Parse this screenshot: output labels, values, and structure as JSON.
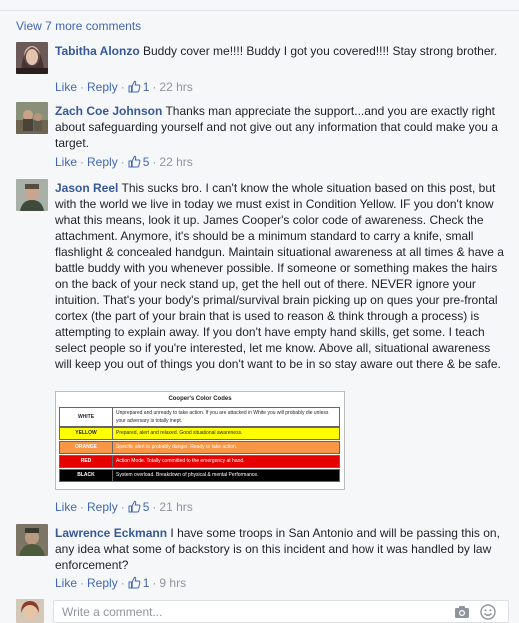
{
  "view_more": "View 7 more comments",
  "actions_common": {
    "like": "Like",
    "reply": "Reply",
    "dot": "·"
  },
  "comments": [
    {
      "author": "Tabitha Alonzo",
      "text": "Buddy cover me!!!! Buddy I got you covered!!!! Stay strong brother.",
      "likes": "1",
      "time": "22 hrs"
    },
    {
      "author": "Zach Coe Johnson",
      "text": "Thanks man appreciate the support...and you are exactly right about safeguarding yourself and not give out any information that could make you a target.",
      "likes": "5",
      "time": "22 hrs"
    },
    {
      "author": "Jason Reel",
      "text": "This sucks bro. I can't know the whole situation based on this post, but with the world we live in today we must exist in Condition Yellow. IF you don't know what this means, look it up. James Cooper's color code of awareness. Check the attachment. Anymore, it's should be a minimum standard to carry a knife, small flashlight & concealed handgun. Maintain situational awareness at all times & have a battle buddy with you whenever possible. If someone or something makes the hairs on the back of your neck stand up, get the hell out of there. NEVER ignore your intuition. That's your body's primal/survival brain picking up on ques your pre-frontal cortex (the part of your brain that is used to reason & think through a process) is attempting to explain away. If you don't have empty hand skills, get some. I teach select people so if you're interested, let me know. Above all, situational awareness will keep you out of things you don't want to be in so stay aware out there & be safe.",
      "likes": "5",
      "time": "21 hrs"
    },
    {
      "author": "Lawrence Eckmann",
      "text": "I have some troops in San Antonio and will be passing this on, any idea what some of backstory is on this incident and how it was handled by law enforcement?",
      "likes": "1",
      "time": "9 hrs"
    }
  ],
  "attachment": {
    "title": "Cooper's Color Codes",
    "rows": [
      {
        "name": "WHITE",
        "desc": "Unprepared and unready to take action. If you are attacked in White you will probably die unless your adversary is totally inept.",
        "bg": "#ffffff",
        "fg": "#000000"
      },
      {
        "name": "YELLOW",
        "desc": "Prepared, alert and relaxed. Good situational awareness.",
        "bg": "#ffff00",
        "fg": "#000000"
      },
      {
        "name": "ORANGE",
        "desc": "Specific alert to probably danger.  Ready to take action.",
        "bg": "#f79646",
        "fg": "#ffffff"
      },
      {
        "name": "RED",
        "desc": "Action Mode.  Totally committed to the emergency at hand.",
        "bg": "#e60000",
        "fg": "#ffffff"
      },
      {
        "name": "BLACK",
        "desc": "System overload.  Breakdown of physical & mental Performance.",
        "bg": "#000000",
        "fg": "#ffffff"
      }
    ]
  },
  "write_comment": {
    "placeholder": "Write a comment..."
  },
  "icons": {
    "like": "thumbs-up-icon",
    "camera": "camera-icon",
    "emoji": "smiley-icon"
  },
  "colors": {
    "link": "#4267b2",
    "author": "#365899",
    "meta": "#90949c"
  }
}
